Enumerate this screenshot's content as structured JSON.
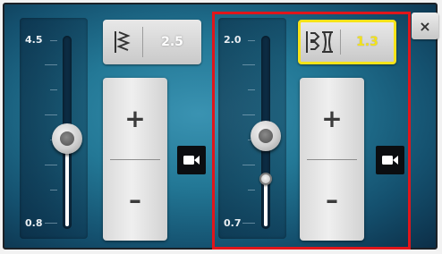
{
  "left_control": {
    "scale_max": "4.5",
    "scale_min": "0.8",
    "value": "2.5",
    "icon": "zigzag-stitch-width-icon"
  },
  "right_control": {
    "scale_max": "2.0",
    "scale_min": "0.7",
    "value": "1.3",
    "icon": "stitch-length-icon",
    "selected": true
  },
  "stepper": {
    "plus_label": "+",
    "minus_label": "–"
  },
  "camera_icon": "video-camera-icon",
  "close_label": "×",
  "colors": {
    "background": "#237896",
    "selected_border": "#f6e31a",
    "selected_value": "#f3e31a",
    "highlight": "#e0161b"
  }
}
